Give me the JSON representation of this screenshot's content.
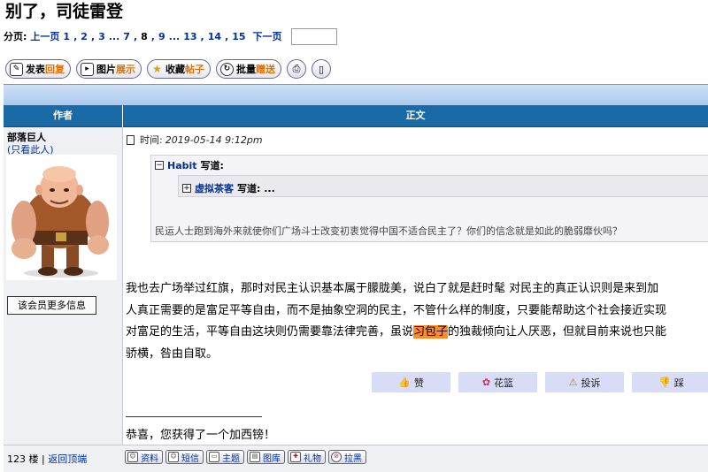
{
  "page": {
    "title": "别了，司徒雷登"
  },
  "pager": {
    "label": "分页:",
    "prev": "上一页",
    "pages": [
      "1",
      "2",
      "3",
      "...",
      "7",
      "8",
      "9",
      "...",
      "13",
      "14",
      "15"
    ],
    "current": "8",
    "next": "下一页",
    "goto_value": ""
  },
  "toolbar": {
    "post_reply": {
      "a": "发表",
      "b": "回复"
    },
    "show_images": {
      "a": "图片",
      "b": "展示"
    },
    "favorite": {
      "a": "收藏",
      "b": "帖子"
    },
    "batch_gift": {
      "a": "批量",
      "b": "赠送"
    }
  },
  "table_headers": {
    "author": "作者",
    "body": "正文"
  },
  "author": {
    "name": "部落巨人",
    "only_this": "(只看此人)",
    "more_info": "该会员更多信息"
  },
  "post": {
    "time_label": "时间:",
    "time_value": "2019-05-14 9:12pm",
    "quote_outer_user": "Habit",
    "quote_outer_suffix": "写道:",
    "quote_inner_user": "虚拟茶客",
    "quote_inner_suffix": "写道: ...",
    "quote_outer_text": "民运人士跑到海外来就使你们广场斗士改变初衷觉得中国不适合民主了？你们的信念就是如此的脆弱靡伙吗？",
    "body_line1": "我也去广场举过红旗，那时对民主认识基本属于朦胧美，说白了就是赶时髦 对民主的真正认识则是来到加",
    "body_line2": "人真正需要的是富足平等自由，而不是抽象空洞的民主，不管什么样的制度，只要能帮助这个社会接近实现",
    "body_line3_a": "对富足的生活，平等自由这块则仍需要靠法律完善，虽说",
    "body_line3_mark": "习包子",
    "body_line3_b": "的独裁倾向让人厌恶，但就目前来说也只能",
    "body_line4": "骄横，咎由自取。",
    "signature": "恭喜，您获得了一个加西镑！"
  },
  "actions": {
    "like": "赞",
    "flower": "花篮",
    "report": "投诉",
    "dislike": "踩"
  },
  "footer": {
    "floor": "123 楼",
    "sep": "|",
    "back_top": "返回顶端",
    "profile": "资料",
    "message": "短信",
    "homepage": "主题",
    "gallery": "图库",
    "gift": "礼物",
    "block": "拉黑"
  },
  "icons": [
    "reply-icon",
    "image-icon",
    "star-icon",
    "refresh-icon",
    "print-icon",
    "phone-icon",
    "thumbs-up-icon",
    "flower-icon",
    "warning-icon",
    "thumbs-down-icon",
    "document-icon",
    "expand-icon"
  ],
  "colors": {
    "header_blue": "#1a6aa6",
    "link_blue": "#00309c",
    "highlight_orange": "#ff8a2a",
    "action_bg": "#d9dcf6"
  }
}
